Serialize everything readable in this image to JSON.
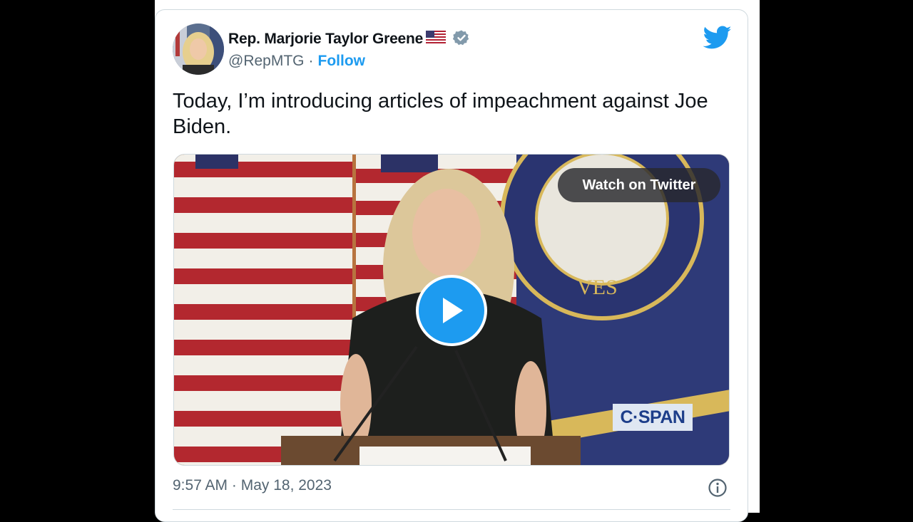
{
  "author": {
    "name": "Rep. Marjorie Taylor Greene",
    "handle": "@RepMTG",
    "separator": "·",
    "follow_label": "Follow"
  },
  "tweet": {
    "text": "Today, I’m introducing articles of impeachment against Joe Biden."
  },
  "media": {
    "watch_label": "Watch on Twitter",
    "network_logo": "C·SPAN"
  },
  "footer": {
    "timestamp": "9:57 AM · May 18, 2023"
  },
  "icons": {
    "twitter": "twitter-bird-icon",
    "verified": "verified-badge-icon",
    "flag": "us-flag-emoji",
    "play": "play-icon",
    "info": "info-icon"
  },
  "colors": {
    "accent": "#1d9bf0",
    "text": "#0f1419",
    "muted": "#536471",
    "border": "#cfd9de",
    "verified_badge": "#829aab"
  }
}
